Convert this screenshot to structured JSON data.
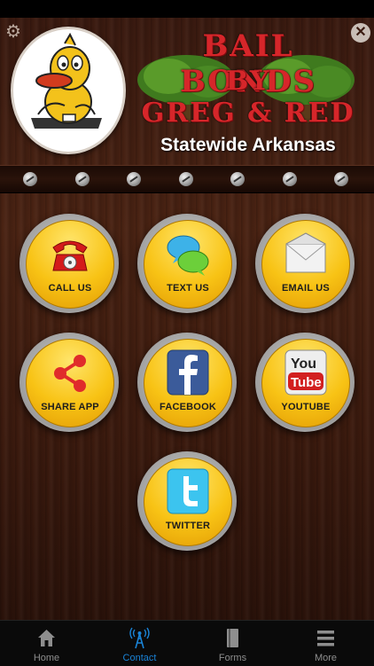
{
  "header": {
    "brand_line1": "BAIL BONDS",
    "brand_line2": "BY",
    "brand_line3": "GREG & RED",
    "tagline": "Statewide Arkansas",
    "brand_color": "#d6262a"
  },
  "buttons": [
    {
      "id": "call",
      "label": "CALL US",
      "icon": "telephone-icon"
    },
    {
      "id": "text",
      "label": "TEXT US",
      "icon": "chat-bubbles-icon"
    },
    {
      "id": "email",
      "label": "EMAIL US",
      "icon": "envelope-icon"
    },
    {
      "id": "share",
      "label": "SHARE APP",
      "icon": "share-icon"
    },
    {
      "id": "facebook",
      "label": "FACEBOOK",
      "icon": "facebook-icon"
    },
    {
      "id": "youtube",
      "label": "YOUTUBE",
      "icon": "youtube-icon"
    },
    {
      "id": "twitter",
      "label": "TWITTER",
      "icon": "twitter-icon"
    }
  ],
  "tabs": [
    {
      "label": "Home",
      "icon": "home-icon",
      "active": false
    },
    {
      "label": "Contact",
      "icon": "radio-tower-icon",
      "active": true
    },
    {
      "label": "Forms",
      "icon": "book-icon",
      "active": false
    },
    {
      "label": "More",
      "icon": "menu-icon",
      "active": false
    }
  ],
  "colors": {
    "accent_tab": "#1a83d6",
    "button_yellow": "#f8c315",
    "wood": "#4a2313"
  }
}
